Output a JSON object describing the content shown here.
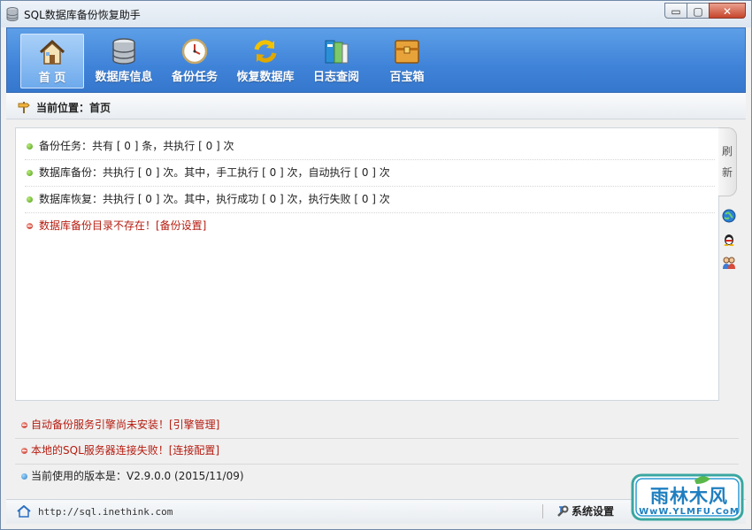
{
  "window": {
    "title": "SQL数据库备份恢复助手",
    "controls": {
      "minimize": "▭",
      "maximize": "▢",
      "close": "✕"
    }
  },
  "toolbar": {
    "items": [
      {
        "label": "首  页",
        "icon": "home-icon",
        "active": true
      },
      {
        "label": "数据库信息",
        "icon": "database-icon"
      },
      {
        "label": "备份任务",
        "icon": "clock-icon"
      },
      {
        "label": "恢复数据库",
        "icon": "refresh-arrows-icon"
      },
      {
        "label": "日志查阅",
        "icon": "books-icon"
      },
      {
        "label": "百宝箱",
        "icon": "treasure-box-icon"
      }
    ]
  },
  "location": {
    "text": "当前位置：首页"
  },
  "main": {
    "rows": [
      {
        "text": "备份任务：共有 [ 0 ] 条，共执行 [ 0 ] 次",
        "status": "ok"
      },
      {
        "text": "数据库备份：共执行 [ 0 ] 次。其中，手工执行 [ 0 ] 次，自动执行 [ 0 ] 次",
        "status": "ok"
      },
      {
        "text": "数据库恢复：共执行 [ 0 ] 次。其中，执行成功 [ 0 ] 次，执行失败 [ 0 ] 次",
        "status": "ok"
      },
      {
        "text": "数据库备份目录不存在！[备份设置]",
        "status": "error"
      }
    ]
  },
  "side": {
    "refresh_char1": "刷",
    "refresh_char2": "新",
    "icons": [
      "globe-icon",
      "qq-penguin-icon",
      "users-icon"
    ]
  },
  "status": {
    "rows": [
      {
        "text": "自动备份服务引擎尚未安装！[引擎管理]",
        "status": "error"
      },
      {
        "text": "本地的SQL服务器连接失败！[连接配置]",
        "status": "error"
      },
      {
        "text": "当前使用的版本是：V2.9.0.0 (2015/11/09)",
        "status": "info"
      }
    ]
  },
  "footer": {
    "url": "http://sql.inethink.com",
    "settings_label": "系统设置"
  },
  "watermark": {
    "text_main": "雨林木风",
    "text_sub": "WwW.YLMFU.CoM"
  },
  "colors": {
    "toolbar_blue": "#3f83d9",
    "error_red": "#b51c10",
    "ok_green": "#4e9c15"
  }
}
